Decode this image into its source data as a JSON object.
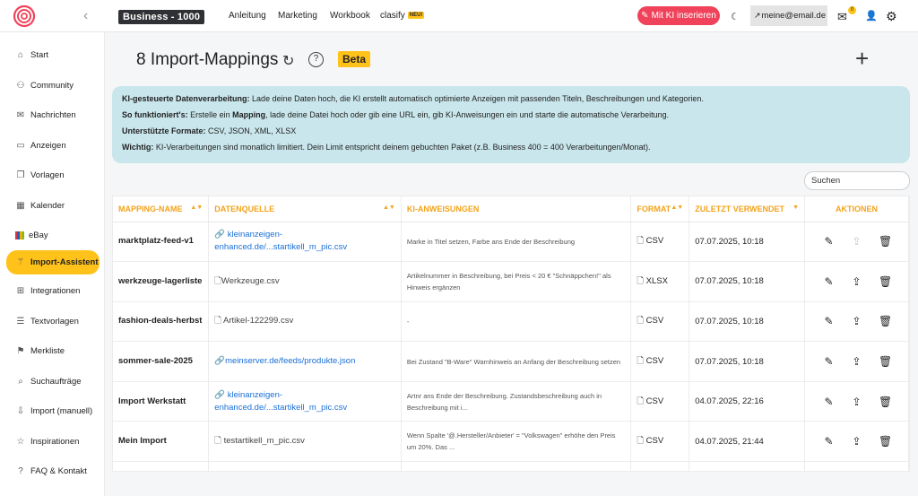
{
  "topbar": {
    "plan_label": "Business - 1000",
    "nav": [
      "Anleitung",
      "Marketing",
      "Workbook",
      "clasify"
    ],
    "neu_badge": "NEU!",
    "ki_button": "Mit KI inserieren",
    "email": "meine@email.de",
    "mail_count": "0",
    "colors": {
      "ki_button": "#f0435b",
      "accent": "#ffc21a"
    }
  },
  "sidebar": {
    "items": [
      {
        "label": "Start",
        "icon": "house-icon"
      },
      {
        "label": "Community",
        "icon": "users-icon"
      },
      {
        "label": "Nachrichten",
        "icon": "envelope-icon"
      },
      {
        "label": "Anzeigen",
        "icon": "ads-icon"
      },
      {
        "label": "Vorlagen",
        "icon": "copy-icon"
      },
      {
        "label": "Kalender",
        "icon": "calendar-icon"
      },
      {
        "label": "eBay",
        "icon": "ebay-icon"
      },
      {
        "label": "Import-Assistent",
        "icon": "magic-wand-icon"
      },
      {
        "label": "Integrationen",
        "icon": "integrations-icon"
      },
      {
        "label": "Textvorlagen",
        "icon": "text-template-icon"
      },
      {
        "label": "Merkliste",
        "icon": "bookmark-icon"
      },
      {
        "label": "Suchaufträge",
        "icon": "search-task-icon"
      },
      {
        "label": "Import (manuell)",
        "icon": "import-icon"
      },
      {
        "label": "Inspirationen",
        "icon": "star-icon"
      },
      {
        "label": "FAQ & Kontakt",
        "icon": "question-icon"
      }
    ],
    "active": "Import-Assistent"
  },
  "main": {
    "title": "8 Import-Mappings",
    "beta": "Beta",
    "info": {
      "line1_bold": "KI-gesteuerte Datenverarbeitung:",
      "line1": " Lade deine Daten hoch, die KI erstellt automatisch optimierte Anzeigen mit passenden Titeln, Beschreibungen und Kategorien.",
      "line2_bold": "So funktioniert's:",
      "line2_a": " Erstelle ein ",
      "line2_b": "Mapping",
      "line2_c": ", lade deine Datei hoch oder gib eine URL ein, gib KI-Anweisungen ein und starte die automatische Verarbeitung.",
      "line3_bold": "Unterstützte Formate:",
      "line3": " CSV, JSON, XML, XLSX",
      "line4_bold": "Wichtig:",
      "line4": " KI-Verarbeitungen sind monatlich limitiert. Dein Limit entspricht deinem gebuchten Paket (z.B. Business 400 = 400 Verarbeitungen/Monat)."
    },
    "search_placeholder": "Suchen",
    "columns": [
      "Mapping-Name",
      "Datenquelle",
      "KI-Anweisungen",
      "Format",
      "Zuletzt verwendet",
      "Aktionen"
    ],
    "rows": [
      {
        "name": "marktplatz-feed-v1",
        "source_l1": "kleinanzeigen-",
        "source_l2": "enhanced.de/...startikell_m_pic.csv",
        "instructions": "Marke in Titel setzen, Farbe ans Ende der Beschreibung",
        "format": "CSV",
        "last_used": "07.07.2025, 10:18"
      },
      {
        "name": "werkzeuge-lagerliste",
        "source_l1": "Werkzeuge.csv",
        "source_l2": "",
        "instructions": "Artikelnummer in Beschreibung, bei Preis < 20 € \"Schnäppchen!\" als Hinweis ergänzen",
        "format": "XLSX",
        "last_used": "07.07.2025, 10:18"
      },
      {
        "name": "fashion-deals-herbst",
        "source_l1": "Artikel-122299.csv",
        "source_l2": "",
        "instructions": "-",
        "format": "CSV",
        "last_used": "07.07.2025, 10:18"
      },
      {
        "name": "sommer-sale-2025",
        "source_l1": "meinserver.de/feeds/produkte.json",
        "source_l2": "",
        "instructions": "Bei Zustand \"B-Ware\" Warnhinweis an Anfang der Beschreibung setzen",
        "format": "CSV",
        "last_used": "07.07.2025, 10:18"
      },
      {
        "name": "Import Werkstatt",
        "source_l1": "kleinanzeigen-",
        "source_l2": "enhanced.de/...startikell_m_pic.csv",
        "instructions": "Artnr ans Ende der Beschreibung. Zustandsbeschreibung auch in Beschreibung mit i...",
        "format": "CSV",
        "last_used": "04.07.2025, 22:16"
      },
      {
        "name": "Mein Import",
        "source_l1": "testartikell_m_pic.csv",
        "source_l2": "",
        "instructions": "Wenn Spalte '@.Hersteller/Anbieter' = \"Volkswagen\" erhöhe den Preis um 20%. Das ...",
        "format": "CSV",
        "last_used": "04.07.2025, 21:44"
      }
    ]
  }
}
